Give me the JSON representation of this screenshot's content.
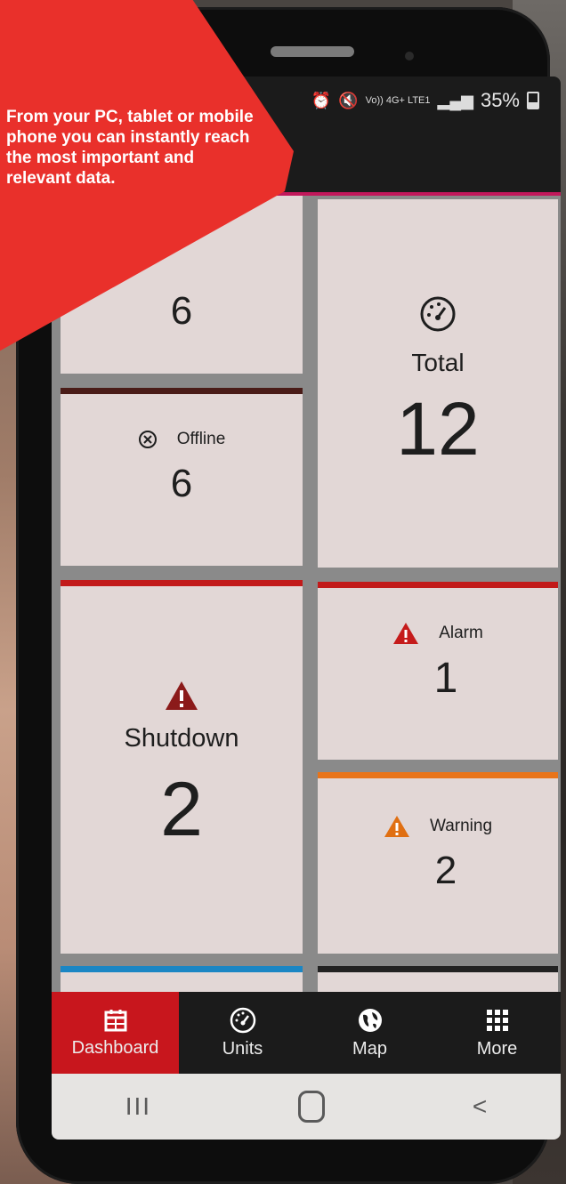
{
  "status": {
    "left_icons": "air",
    "right_net": "Vo)) 4G+ LTE1",
    "battery": "35%"
  },
  "callout": {
    "text": "From your PC, tablet or mobile phone you can instantly reach the most important and relevant data."
  },
  "tiles": {
    "top_left": {
      "value": "6"
    },
    "total": {
      "label": "Total",
      "value": "12",
      "icon": "speedometer-icon"
    },
    "offline": {
      "label": "Offline",
      "value": "6",
      "icon": "close-circle-icon"
    },
    "shutdown": {
      "label": "Shutdown",
      "value": "2",
      "icon": "warning-icon",
      "color": "#8b1a1a"
    },
    "alarm": {
      "label": "Alarm",
      "value": "1",
      "icon": "warning-icon",
      "color": "#c51b1b"
    },
    "warning": {
      "label": "Warning",
      "value": "2",
      "icon": "warning-icon",
      "color": "#e06f12"
    }
  },
  "colors": {
    "offline_bar": "#4a1c18",
    "shutdown_bar": "#c21a1a",
    "alarm_bar": "#c21a1a",
    "warning_bar": "#e8741a",
    "bottom_left_bar": "#1b86c4",
    "bottom_right_bar": "#222222",
    "nav_active": "#c8161d",
    "callout": "#e9302b"
  },
  "nav": {
    "items": [
      {
        "label": "Dashboard",
        "icon": "calendar-icon"
      },
      {
        "label": "Units",
        "icon": "speedometer-icon"
      },
      {
        "label": "Map",
        "icon": "globe-icon"
      },
      {
        "label": "More",
        "icon": "grid-icon"
      }
    ]
  },
  "sysnav": {
    "recents": "III",
    "back": "<"
  }
}
